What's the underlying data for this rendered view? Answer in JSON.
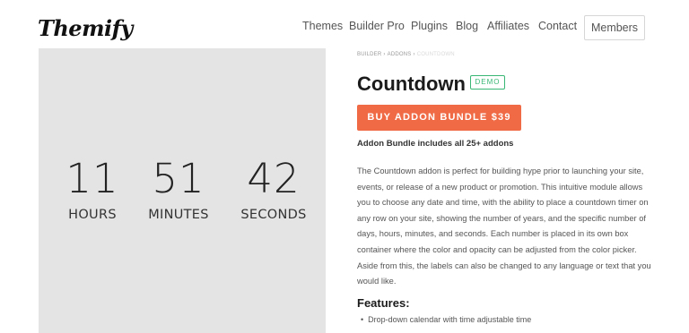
{
  "header": {
    "logo": "Themify",
    "nav": [
      {
        "label": "Themes"
      },
      {
        "label": "Builder Pro"
      },
      {
        "label": "Plugins"
      },
      {
        "label": "Blog"
      },
      {
        "label": "Affiliates"
      },
      {
        "label": "Contact"
      }
    ],
    "members_label": "Members"
  },
  "countdown": [
    {
      "value": "11",
      "label": "HOURS"
    },
    {
      "value": "51",
      "label": "MINUTES"
    },
    {
      "value": "42",
      "label": "SECONDS"
    }
  ],
  "breadcrumb": {
    "items": [
      "BUILDER",
      "ADDONS",
      "COUNTDOWN"
    ],
    "separator": "›"
  },
  "product": {
    "title": "Countdown",
    "demo_label": "DEMO",
    "buy_label": "BUY ADDON BUNDLE $39",
    "bundle_note": "Addon Bundle includes all 25+ addons",
    "description": "The Countdown addon is perfect for building hype prior to launching your site, events, or release of a new product or promotion. This intuitive module allows you to choose any date and time, with the ability to place a countdown timer on any row on your site, showing the number of years, and the specific number of days, hours, minutes, and seconds. Each number is placed in its own box container where the color and opacity can be adjusted from the color picker. Aside from this, the labels can also be changed to any language or text that you would like.",
    "features_title": "Features:",
    "features": [
      "Drop-down calendar with time adjustable time"
    ]
  },
  "colors": {
    "accent": "#ef6a45",
    "demo": "#38b774",
    "preview_bg": "#e4e4e4"
  }
}
